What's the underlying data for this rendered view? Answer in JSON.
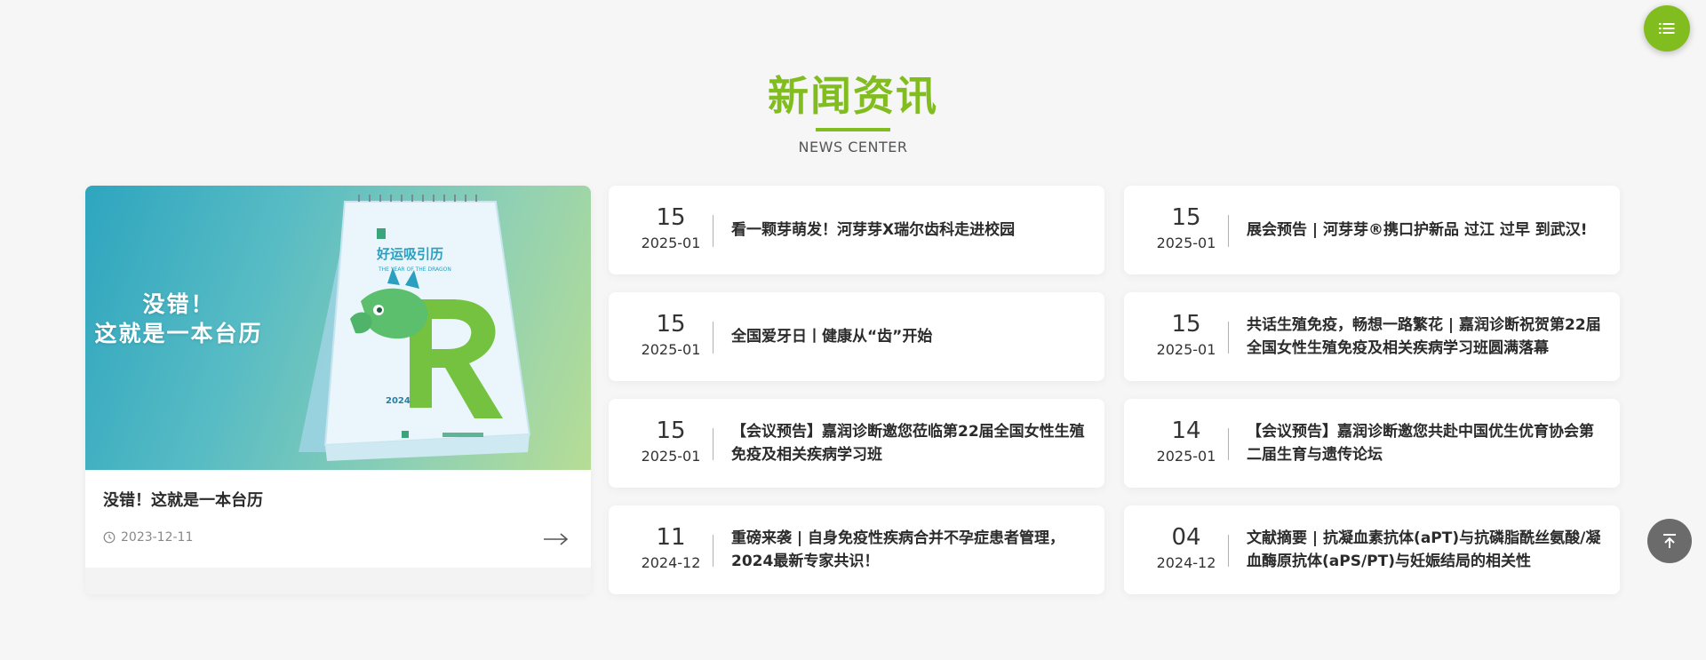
{
  "section": {
    "title": "新闻资讯",
    "subtitle": "NEWS CENTER"
  },
  "featured": {
    "image_text_line1": "没错！",
    "image_text_line2": "这就是一本台历",
    "calendar_title": "好运吸引历",
    "calendar_subtitle": "THE YEAR OF THE DRAGON",
    "calendar_year": "2024",
    "title": "没错！这就是一本台历",
    "date": "2023-12-11",
    "icons": {
      "date": "clock-icon",
      "more": "arrow-right-icon"
    }
  },
  "news": [
    {
      "day": "15",
      "month": "2025-01",
      "title": "看一颗芽萌发！河芽芽X瑞尔齿科走进校园"
    },
    {
      "day": "15",
      "month": "2025-01",
      "title": "展会预告 | 河芽芽®携口护新品 过江 过早 到武汉!"
    },
    {
      "day": "15",
      "month": "2025-01",
      "title": "全国爱牙日丨健康从“齿”开始"
    },
    {
      "day": "15",
      "month": "2025-01",
      "title": "共话生殖免疫，畅想一路繁花 | 嘉润诊断祝贺第22届全国女性生殖免疫及相关疾病学习班圆满落幕"
    },
    {
      "day": "15",
      "month": "2025-01",
      "title": "【会议预告】嘉润诊断邀您莅临第22届全国女性生殖免疫及相关疾病学习班"
    },
    {
      "day": "14",
      "month": "2025-01",
      "title": "【会议预告】嘉润诊断邀您共赴中国优生优育协会第二届生育与遗传论坛"
    },
    {
      "day": "11",
      "month": "2024-12",
      "title": "重磅来袭 | 自身免疫性疾病合并不孕症患者管理，2024最新专家共识！"
    },
    {
      "day": "04",
      "month": "2024-12",
      "title": "文献摘要 | 抗凝血素抗体(aPT)与抗磷脂酰丝氨酸/凝血酶原抗体(aPS/PT)与妊娠结局的相关性"
    }
  ],
  "buttons": {
    "menu_icon": "list-icon",
    "top_icon": "back-to-top-icon"
  },
  "colors": {
    "accent": "#82bd1f",
    "background": "#f6f6f6",
    "text": "#2b2b2b"
  }
}
